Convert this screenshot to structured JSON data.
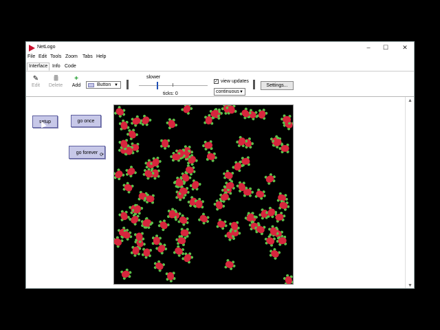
{
  "window": {
    "title": "NetLogo"
  },
  "window_controls": {
    "minimize": "–",
    "maximize": "☐",
    "close": "✕"
  },
  "menu": [
    "File",
    "Edit",
    "Tools",
    "Zoom",
    "Tabs",
    "Help"
  ],
  "tabs": [
    "Interface",
    "Info",
    "Code"
  ],
  "active_tab": "Interface",
  "toolbar": {
    "edit": "Edit",
    "delete": "Delete",
    "add": "Add",
    "widget_type": "Button",
    "speed_label": "slower",
    "ticks_label": "ticks: 0",
    "view_updates_label": "view updates",
    "view_updates_checked": true,
    "update_mode": "continuous",
    "settings_label": "Settings..."
  },
  "buttons": {
    "setup": "setup",
    "go_once": "go once",
    "go_forever": "go forever"
  },
  "colors": {
    "turtle": "#d7263d",
    "turtle_limbs": "#5cc24a",
    "world_background": "#000000",
    "button_fill": "#c7c8e8"
  },
  "icons": {
    "app": "netlogo-logo-icon",
    "edit": "pencil-icon",
    "delete": "trash-icon",
    "add": "plus-icon",
    "forever": "loop-icon",
    "cursor": "mouse-pointer-icon"
  }
}
